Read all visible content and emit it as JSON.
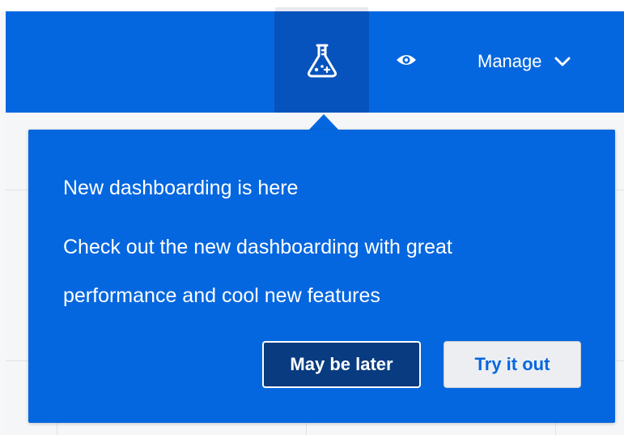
{
  "header": {
    "nav_tabs": [
      {
        "icon": "flask-icon",
        "active": true
      },
      {
        "icon": "eye-icon",
        "active": false
      }
    ],
    "manage_label": "Manage",
    "manage_icon": "chevron-down-icon"
  },
  "popover": {
    "title": "New dashboarding is here",
    "body": "Check out the new dashboarding with great performance and cool new features",
    "later_label": "May be later",
    "try_label": "Try it out"
  },
  "colors": {
    "header_blue": "#0567df",
    "active_tab_blue": "#0653bd",
    "button_dark_blue": "#083b80",
    "button_light": "#eceef2"
  }
}
